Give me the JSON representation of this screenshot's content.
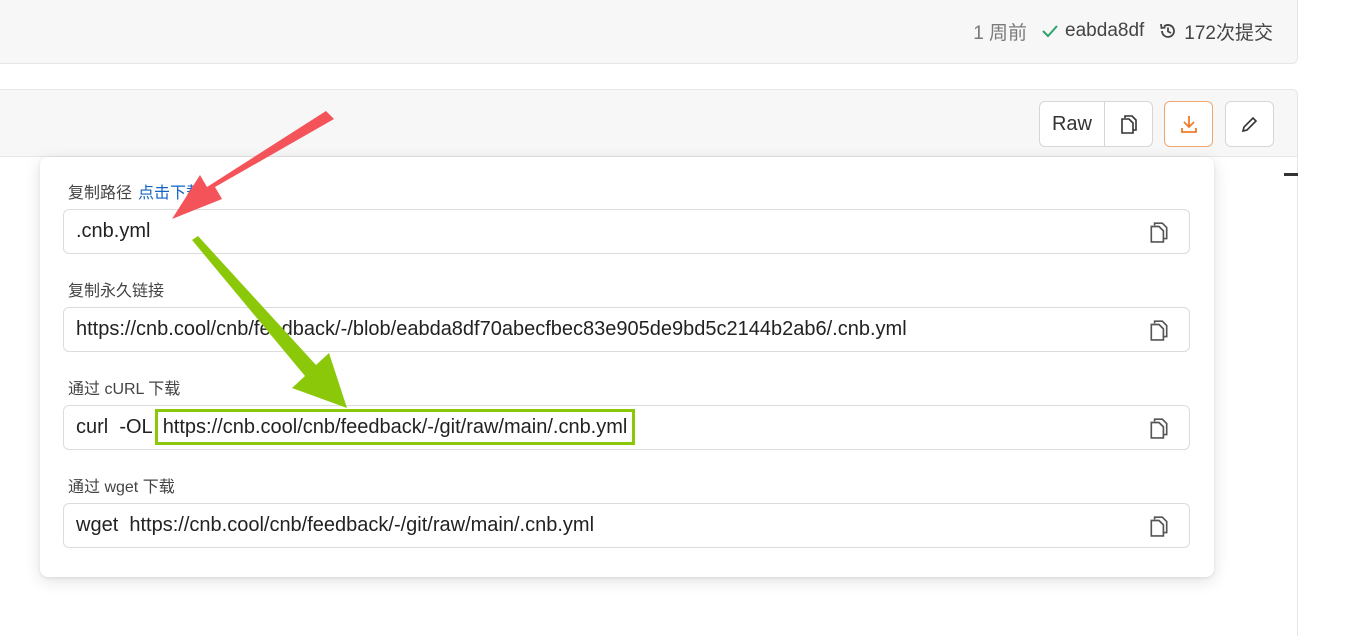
{
  "commit": {
    "time": "1 周前",
    "hash": "eabda8df",
    "count": "172次提交",
    "check_icon": "check-icon",
    "history_icon": "history-icon"
  },
  "toolbar": {
    "raw_label": "Raw",
    "copy_icon": "copy-icon",
    "download_icon": "download-icon",
    "edit_icon": "pencil-icon",
    "accent_color": "#f07c2a"
  },
  "panel": {
    "path": {
      "label": "复制路径",
      "link": "点击下载",
      "value": ".cnb.yml"
    },
    "permalink": {
      "label": "复制永久链接",
      "value": "https://cnb.cool/cnb/feedback/-/blob/eabda8df70abecfbec83e905de9bd5c2144b2ab6/.cnb.yml"
    },
    "curl": {
      "label": "通过 cURL 下载",
      "command": "curl  -OL",
      "url": "https://cnb.cool/cnb/feedback/-/git/raw/main/.cnb.yml"
    },
    "wget": {
      "label": "通过 wget 下载",
      "value": "wget  https://cnb.cool/cnb/feedback/-/git/raw/main/.cnb.yml"
    }
  },
  "annotations": {
    "red_arrow_color": "#f4535a",
    "green_arrow_color": "#8cc80a",
    "highlight_color": "#8cc80a"
  }
}
